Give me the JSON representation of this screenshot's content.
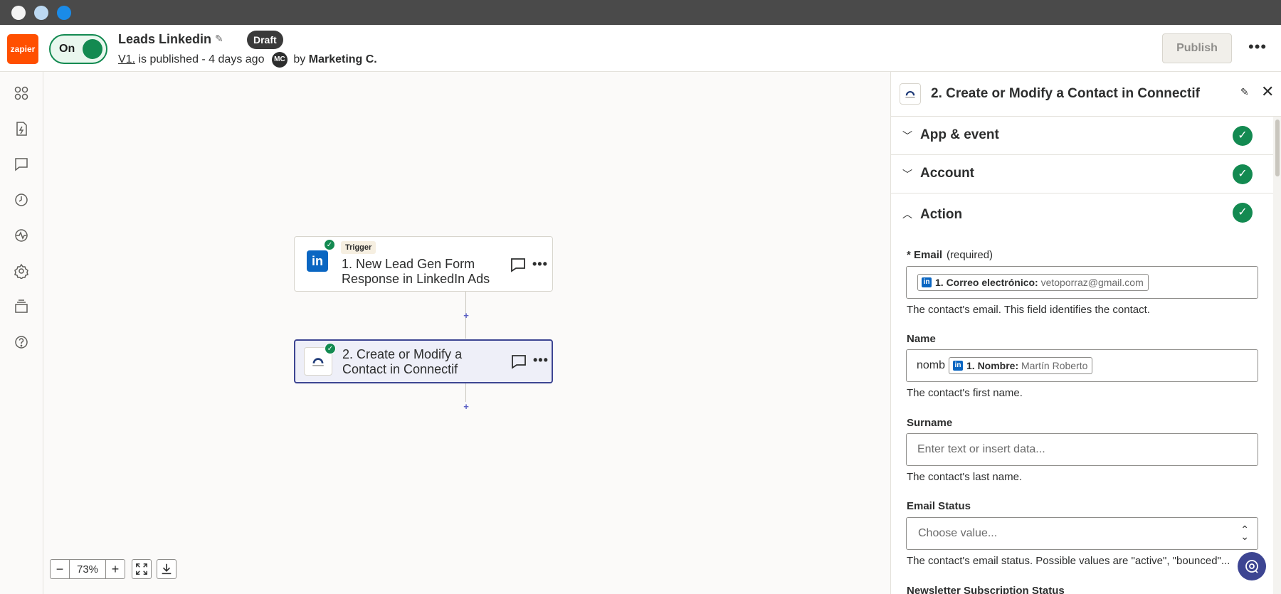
{
  "header": {
    "logo_text": "zapier",
    "toggle_label": "On",
    "zap_title": "Leads Linkedin",
    "status_badge": "Draft",
    "version_link": "V1.",
    "version_text": " is published - 4 days ago",
    "avatar_initials": "MC",
    "by_text": "by",
    "author": "Marketing C.",
    "publish_label": "Publish"
  },
  "sidebar": {
    "items": [
      "apps-icon",
      "zap-details-icon",
      "comments-icon",
      "history-icon",
      "activity-icon",
      "settings-icon",
      "versions-icon",
      "help-icon"
    ]
  },
  "canvas": {
    "steps": [
      {
        "chip": "Trigger",
        "title": "1. New Lead Gen Form Response in LinkedIn Ads",
        "icon": "linkedin-icon",
        "status": "complete"
      },
      {
        "title": "2. Create or Modify a Contact in Connectif",
        "icon": "connectif-icon",
        "status": "complete",
        "selected": true
      }
    ],
    "zoom": "73%"
  },
  "panel": {
    "title": "2. Create or Modify a Contact in Connectif",
    "sections": [
      {
        "title": "App & event",
        "expanded": false,
        "complete": true
      },
      {
        "title": "Account",
        "expanded": false,
        "complete": true
      },
      {
        "title": "Action",
        "expanded": true,
        "complete": true
      }
    ],
    "fields": {
      "email": {
        "label": "* Email",
        "required": "(required)",
        "pill_key": "1. Correo electrónico:",
        "pill_value": "vetoporraz@gmail.com",
        "help": "The contact's email. This field identifies the contact."
      },
      "name": {
        "label": "Name",
        "typed": "nomb",
        "pill_key": "1. Nombre:",
        "pill_value": "Martín Roberto",
        "help": "The contact's first name."
      },
      "surname": {
        "label": "Surname",
        "placeholder": "Enter text or insert data...",
        "help": "The contact's last name."
      },
      "email_status": {
        "label": "Email Status",
        "placeholder": "Choose value...",
        "help": "The contact's email status. Possible values are \"active\", \"bounced\"..."
      },
      "newsletter": {
        "label": "Newsletter Subscription Status"
      }
    }
  },
  "colors": {
    "brand": "#ff4f00",
    "success": "#138a51",
    "selected_border": "#3d4592",
    "linkedin": "#0a66c2"
  }
}
